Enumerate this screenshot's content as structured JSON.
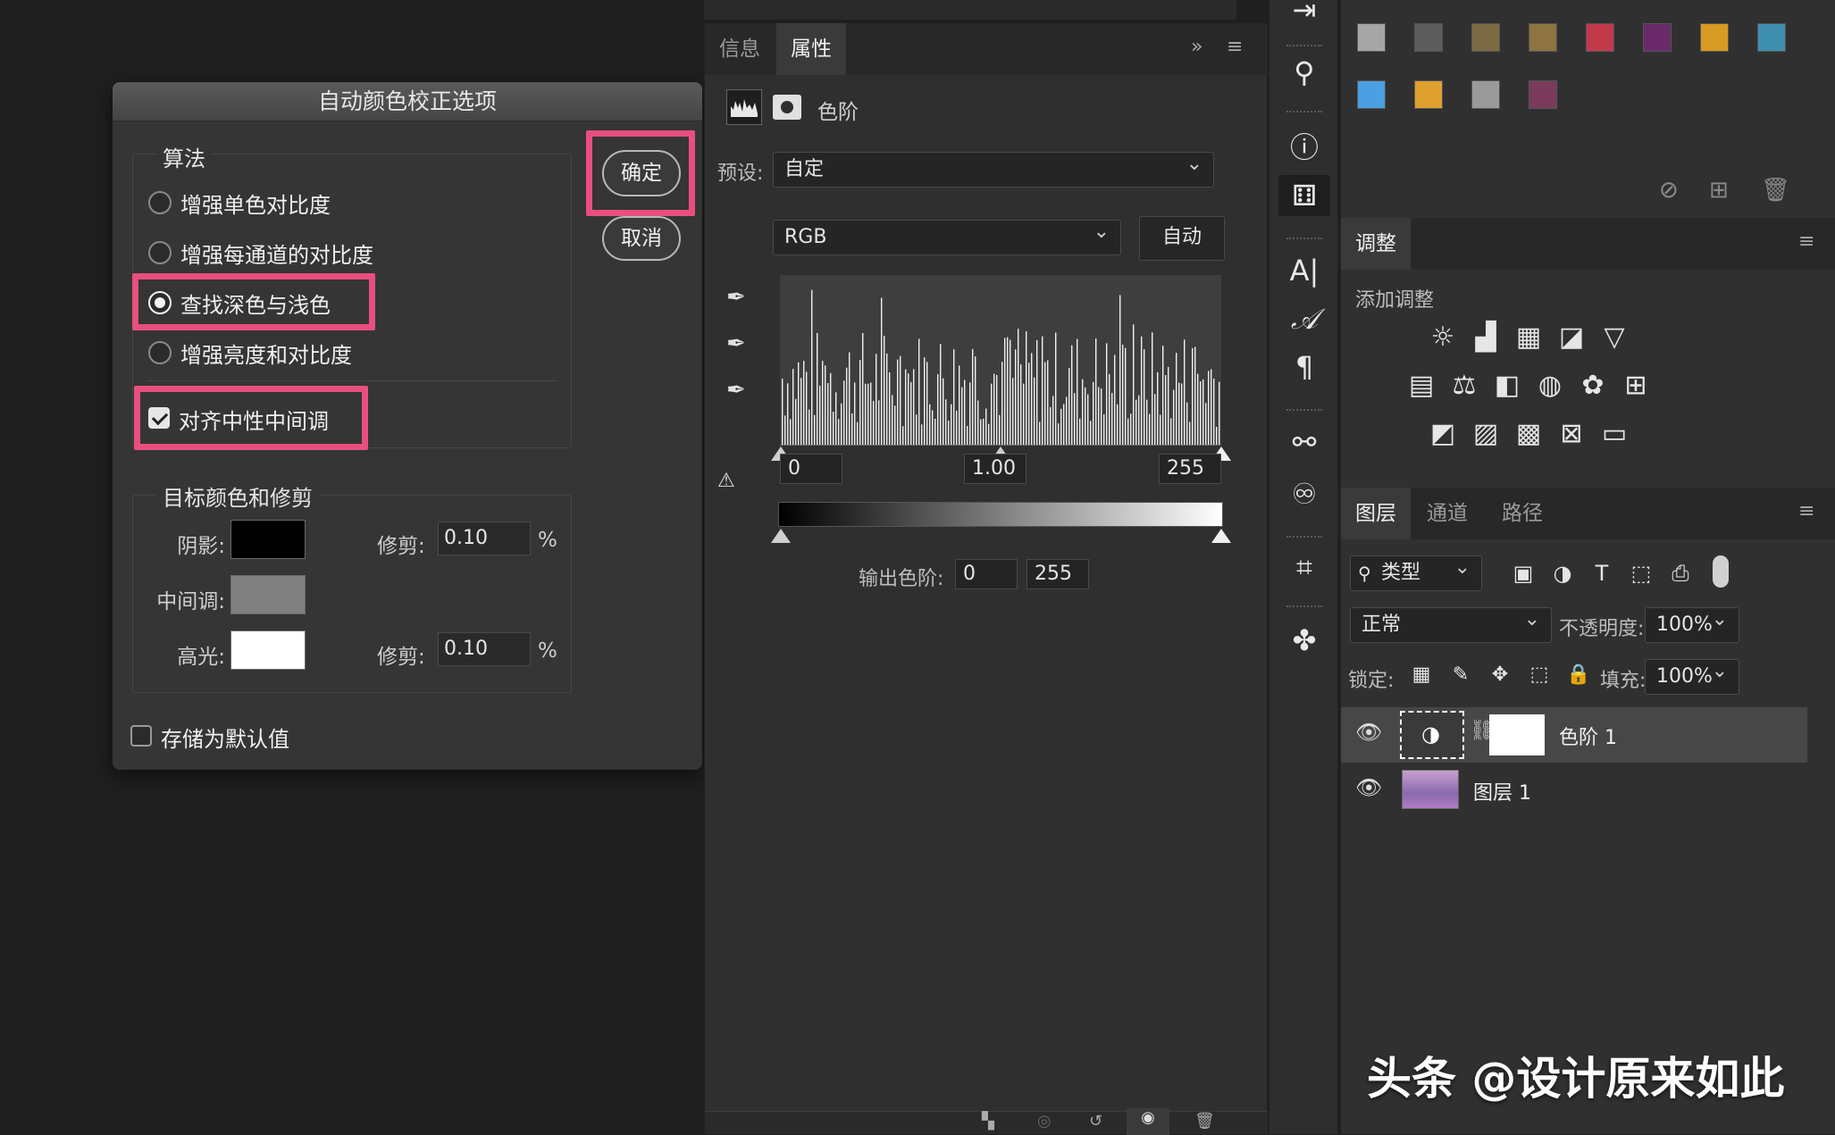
{
  "dialog": {
    "title": "自动颜色校正选项",
    "algorithm_legend": "算法",
    "options": [
      {
        "label": "增强单色对比度",
        "selected": false
      },
      {
        "label": "增强每通道的对比度",
        "selected": false
      },
      {
        "label": "查找深色与浅色",
        "selected": true
      },
      {
        "label": "增强亮度和对比度",
        "selected": false
      }
    ],
    "snap_neutral": {
      "label": "对齐中性中间调",
      "checked": true
    },
    "ok_label": "确定",
    "cancel_label": "取消",
    "target_legend": "目标颜色和修剪",
    "shadows_label": "阴影:",
    "midtones_label": "中间调:",
    "highlights_label": "高光:",
    "clip_label": "修剪:",
    "shadow_clip": "0.10",
    "highlight_clip": "0.10",
    "percent": "%",
    "save_default": {
      "label": "存储为默认值",
      "checked": false
    },
    "colors": {
      "shadow": "#000000",
      "midtone": "#808080",
      "highlight": "#ffffff",
      "highlight_box": "#e94f7e"
    }
  },
  "properties": {
    "tabs": [
      "信息",
      "属性"
    ],
    "active_tab": "属性",
    "panel_title": "色阶",
    "preset_label": "预设:",
    "preset_value": "自定",
    "channel_value": "RGB",
    "auto_label": "自动",
    "input_black": "0",
    "input_gamma": "1.00",
    "input_white": "255",
    "output_label": "输出色阶:",
    "output_black": "0",
    "output_white": "255"
  },
  "swatches": [
    "#a6a6a6",
    "#5d5d5d",
    "#7c6a45",
    "#8d7440",
    "#c23a4a",
    "#6a2a6a",
    "#d89a20",
    "#3f8fb0",
    "#4aa0e0",
    "#e0a030",
    "#9a9a9a",
    "#7a3a5a"
  ],
  "adjustments": {
    "tab": "调整",
    "add_label": "添加调整"
  },
  "layers": {
    "tabs": [
      "图层",
      "通道",
      "路径"
    ],
    "filter_label": "类型",
    "blend_mode": "正常",
    "opacity_label": "不透明度:",
    "opacity_value": "100%",
    "lock_label": "锁定:",
    "fill_label": "填充:",
    "fill_value": "100%",
    "items": [
      {
        "name": "色阶 1",
        "selected": true
      },
      {
        "name": "图层 1",
        "selected": false
      }
    ]
  },
  "watermark": "头条 @设计原来如此"
}
